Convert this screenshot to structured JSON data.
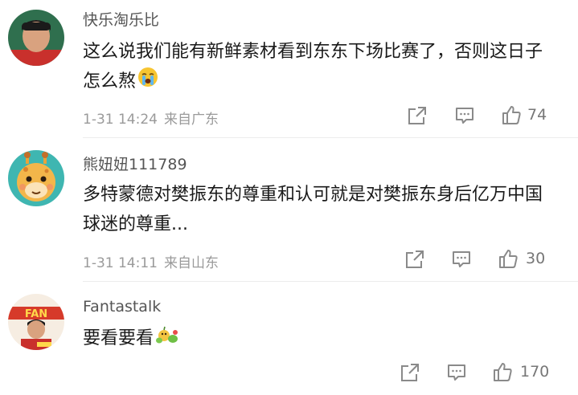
{
  "comments": [
    {
      "username": "快乐淘乐比",
      "text": "这么说我们能有新鲜素材看到东东下场比赛了，否则这日子怎么熬",
      "emoji": "crying-face",
      "time": "1-31 14:24",
      "location": "来自广东",
      "likes": "74"
    },
    {
      "username": "熊妞妞111789",
      "text": "多特蒙德对樊振东的尊重和认可就是对樊振东身后亿万中国球迷的尊重...",
      "time": "1-31 14:11",
      "location": "来自山东",
      "likes": "30"
    },
    {
      "username": "Fantastalk",
      "text": "要看要看",
      "emoji": "fruit-emoji",
      "likes": "170",
      "avatar_text": "FAN"
    }
  ],
  "colors": {
    "meta": "#9a9a9a",
    "text": "#1a1a1a",
    "username": "#555555",
    "icon": "#8a8a8a"
  }
}
